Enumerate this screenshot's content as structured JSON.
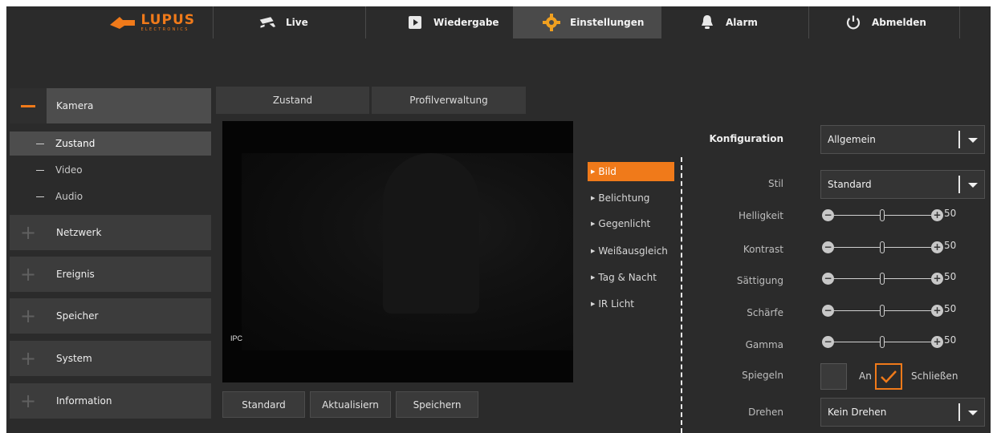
{
  "nav": {
    "brand": "LUPUS",
    "brand_sub": "ELECTRONICS",
    "items": [
      {
        "label": "Live",
        "icon": "camera-icon"
      },
      {
        "label": "Wiedergabe",
        "icon": "play-icon"
      },
      {
        "label": "Einstellungen",
        "icon": "gear-icon",
        "active": true
      },
      {
        "label": "Alarm",
        "icon": "bell-icon"
      },
      {
        "label": "Abmelden",
        "icon": "power-icon"
      }
    ]
  },
  "sidebar": {
    "sections": [
      {
        "label": "Kamera",
        "expanded": true
      },
      {
        "label": "Netzwerk"
      },
      {
        "label": "Ereignis"
      },
      {
        "label": "Speicher"
      },
      {
        "label": "System"
      },
      {
        "label": "Information"
      }
    ],
    "sub_items": [
      {
        "label": "Zustand",
        "active": true
      },
      {
        "label": "Video"
      },
      {
        "label": "Audio"
      }
    ]
  },
  "tabs": [
    {
      "label": "Zustand",
      "active": true
    },
    {
      "label": "Profilverwaltung"
    }
  ],
  "preview": {
    "overlay": "IPC"
  },
  "buttons": {
    "standard": "Standard",
    "refresh": "Aktualisiern",
    "save": "Speichern"
  },
  "menu": [
    {
      "label": "Bild",
      "active": true
    },
    {
      "label": "Belichtung"
    },
    {
      "label": "Gegenlicht"
    },
    {
      "label": "Weißausgleich"
    },
    {
      "label": "Tag & Nacht"
    },
    {
      "label": "IR Licht"
    }
  ],
  "config": {
    "title": "Konfiguration",
    "profile": "Allgemein",
    "style_label": "Stil",
    "style_value": "Standard",
    "sliders": [
      {
        "label": "Helligkeit",
        "value": 50
      },
      {
        "label": "Kontrast",
        "value": 50
      },
      {
        "label": "Sättigung",
        "value": 50
      },
      {
        "label": "Schärfe",
        "value": 50
      },
      {
        "label": "Gamma",
        "value": 50
      }
    ],
    "mirror_label": "Spiegeln",
    "mirror_on": "An",
    "mirror_off": "Schließen",
    "rotate_label": "Drehen",
    "rotate_value": "Kein Drehen"
  },
  "colors": {
    "accent": "#f07a1a",
    "panel": "#2b2b2b"
  }
}
